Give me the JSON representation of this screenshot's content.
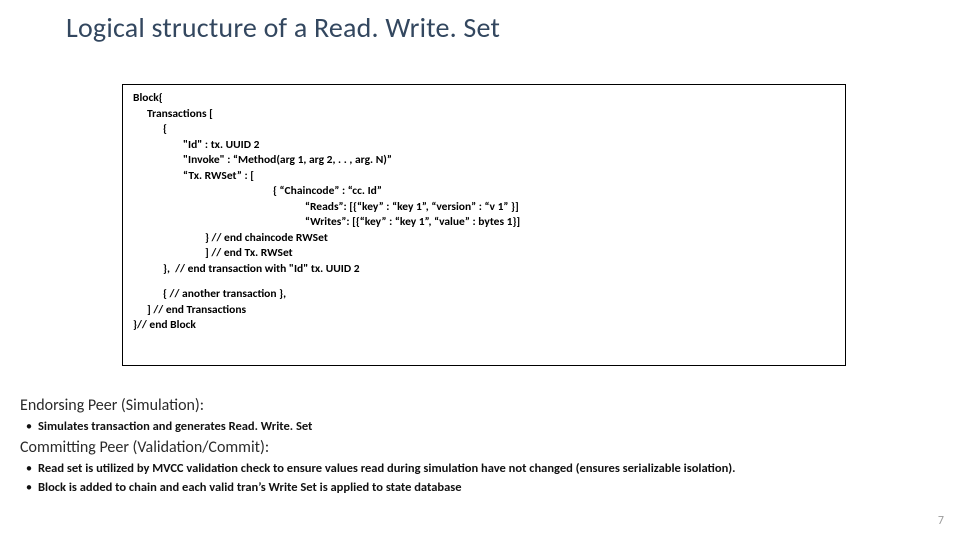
{
  "title": "Logical structure of a Read. Write. Set",
  "code": {
    "l1": "Block{",
    "l2": "Transactions [",
    "l3": "{",
    "l4": "\"Id\" : tx. UUID 2",
    "l5": "\"Invoke\" : “Method(arg 1, arg 2, . . , arg. N)”",
    "l6": "“Tx. RWSet” : [",
    "l7": "{ “Chaincode” : “cc. Id”",
    "l8": "“Reads”: [{“key” : “key 1”, “version” : “v 1” }]",
    "l9": "“Writes”: [{“key” : “key 1”, “value” : bytes 1}]",
    "l10": "} // end chaincode RWSet",
    "l11": "] // end Tx. RWSet",
    "l12": "},  // end transaction with \"Id\" tx. UUID 2",
    "l13": "{ // another transaction },",
    "l14": "] // end Transactions",
    "l15": "}// end Block"
  },
  "sections": {
    "endorsing": {
      "heading": "Endorsing Peer (Simulation):",
      "bullet": "Simulates transaction and generates Read. Write. Set"
    },
    "committing": {
      "heading": "Committing Peer (Validation/Commit):",
      "bullet1": "Read set is utilized by MVCC validation check to ensure values read during simulation have not changed (ensures serializable isolation).",
      "bullet2": "Block is added to chain and each valid tran’s Write Set is applied to state database"
    }
  },
  "page_number": "7"
}
